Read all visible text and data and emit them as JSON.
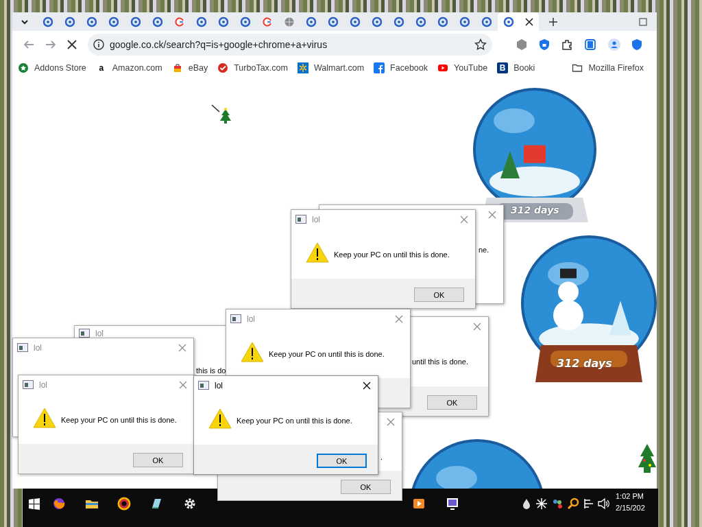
{
  "browser": {
    "tabs": [
      {
        "selected": false
      },
      {
        "selected": false
      },
      {
        "selected": false
      },
      {
        "selected": false
      },
      {
        "selected": false
      },
      {
        "selected": false
      },
      {
        "selected": false
      },
      {
        "selected": false
      },
      {
        "selected": false
      },
      {
        "selected": false
      },
      {
        "selected": false
      },
      {
        "selected": false
      },
      {
        "selected": false
      },
      {
        "selected": false
      },
      {
        "selected": false
      },
      {
        "selected": false
      },
      {
        "selected": false
      },
      {
        "selected": false
      },
      {
        "selected": false
      },
      {
        "selected": false
      },
      {
        "selected": false
      },
      {
        "selected": true
      }
    ],
    "address": "google.co.ck/search?q=is+google+chrome+a+virus",
    "bookmarks": [
      {
        "label": "Addons Store"
      },
      {
        "label": "Amazon.com",
        "icon_text": "a"
      },
      {
        "label": "eBay"
      },
      {
        "label": "TurboTax.com"
      },
      {
        "label": "Walmart.com"
      },
      {
        "label": "Facebook"
      },
      {
        "label": "YouTube"
      },
      {
        "label": "Booki",
        "icon_text": "B"
      },
      {
        "label": "Mozilla Firefox"
      }
    ]
  },
  "globes": [
    {
      "kind": "stand",
      "label": "312 days"
    },
    {
      "kind": "stand",
      "label": "312 days"
    },
    {
      "kind": "cut"
    }
  ],
  "dialogs": [
    {
      "kind": "fragment",
      "message": "ne.",
      "focused": false
    },
    {
      "kind": "full",
      "title": "lol",
      "message": "Keep your PC on until this is done.",
      "button": "OK",
      "focused": false
    },
    {
      "kind": "fragment",
      "message": "until this is done.",
      "button": "OK",
      "focused": false
    },
    {
      "kind": "fragment",
      "title": "lol",
      "message": "this is do",
      "focused": false
    },
    {
      "kind": "fragment",
      "title": "lol",
      "focused": false
    },
    {
      "kind": "full",
      "title": "lol",
      "message": "Keep your PC on until this is done.",
      "focused": false
    },
    {
      "kind": "full",
      "title": "lol",
      "message": "Keep your PC on until this is done.",
      "button": "OK",
      "focused": false
    },
    {
      "kind": "fragment",
      "message": ".",
      "button": "OK",
      "focused": false
    },
    {
      "kind": "full",
      "title": "lol",
      "message": "Keep your PC on until this is done.",
      "button": "OK",
      "focused": true
    }
  ],
  "taskbar": {
    "time": "1:02 PM",
    "date": "2/15/202"
  }
}
